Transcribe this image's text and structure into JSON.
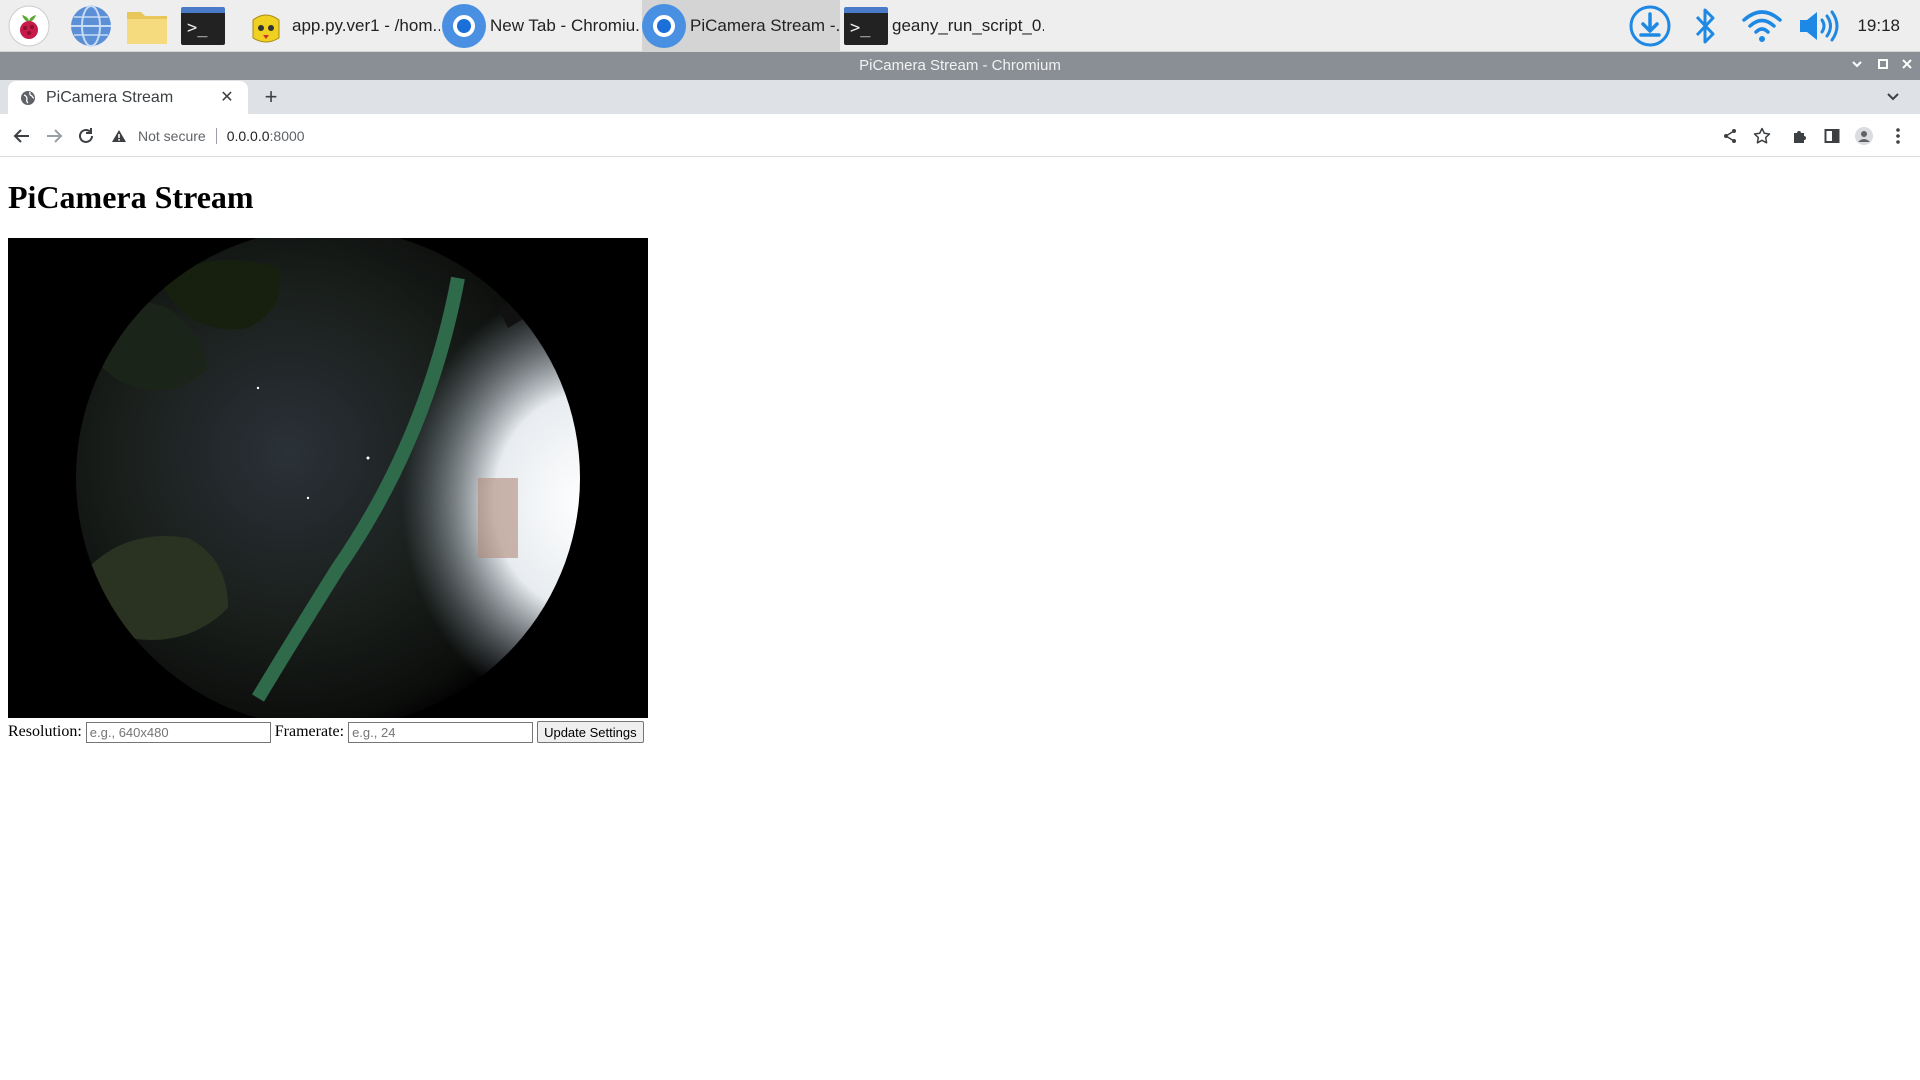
{
  "taskbar": {
    "launchers": [
      {
        "icon": "raspberry-menu-icon"
      },
      {
        "icon": "web-browser-icon"
      },
      {
        "icon": "file-manager-icon"
      },
      {
        "icon": "terminal-icon"
      }
    ],
    "tasks": [
      {
        "label": "app.py.ver1 - /hom...",
        "icon": "thonny-icon",
        "active": false
      },
      {
        "label": "New Tab - Chromiu...",
        "icon": "chromium-icon",
        "active": false
      },
      {
        "label": "PiCamera Stream -...",
        "icon": "chromium-icon",
        "active": true
      },
      {
        "label": "geany_run_script_0...",
        "icon": "terminal-icon",
        "active": false
      }
    ],
    "tray": [
      "download-icon",
      "bluetooth-icon",
      "wifi-icon",
      "volume-icon"
    ],
    "clock": "19:18"
  },
  "window": {
    "title": "PiCamera Stream - Chromium"
  },
  "browser": {
    "tab": {
      "title": "PiCamera Stream"
    },
    "new_tab": "+",
    "address": {
      "security": "Not secure",
      "host": "0.0.0.0",
      "port": ":8000"
    }
  },
  "page": {
    "heading": "PiCamera Stream",
    "resolution_label": "Resolution:",
    "resolution_placeholder": "e.g., 640x480",
    "framerate_label": "Framerate:",
    "framerate_placeholder": "e.g., 24",
    "update_button": "Update Settings"
  },
  "colors": {
    "taskbar_bg": "#eeeeee",
    "titlebar_bg": "#898f94",
    "tabstrip_bg": "#dee1e6",
    "tray_accent": "#1e88e5"
  }
}
